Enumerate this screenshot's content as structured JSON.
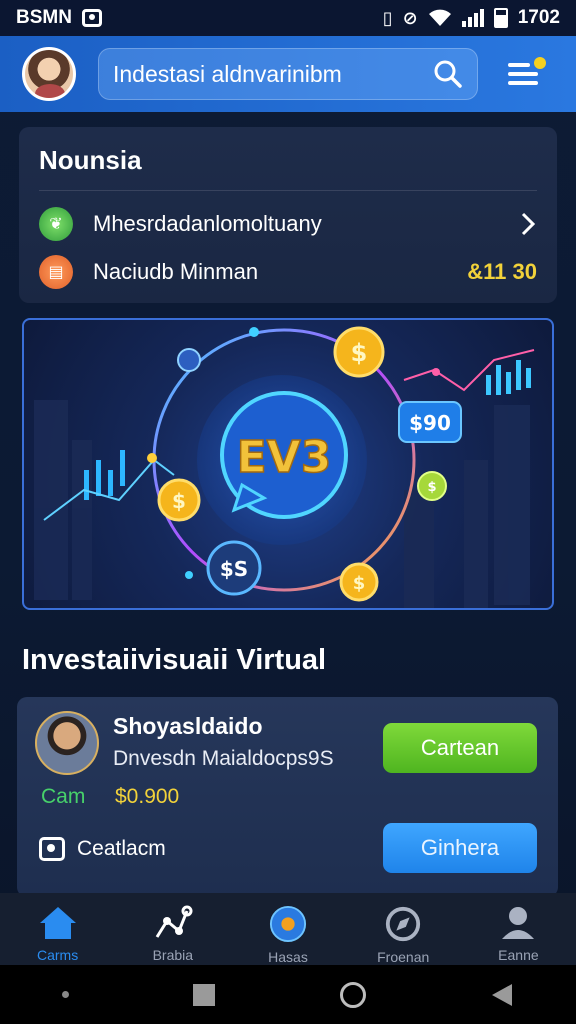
{
  "status_bar": {
    "carrier": "BSMN",
    "time": "1702"
  },
  "header": {
    "search_text": "Indestasi aldnvarinibm",
    "icons": [
      "avatar",
      "search-icon",
      "menu-icon"
    ]
  },
  "notice": {
    "title": "Nounsia",
    "rows": [
      {
        "label": "Mhesrdadanlomoltuany",
        "icon": "leaf-icon",
        "trailing": "chevron-right-icon"
      },
      {
        "label": "Naciudb Minman",
        "icon": "wallet-icon",
        "amount": "&11 30"
      }
    ]
  },
  "banner": {
    "logo_text": "EV3",
    "price_tag": "$90",
    "coin_symbol": "$",
    "dollar_bubble": "$S"
  },
  "section": {
    "title": "Investaiivisuaii Virtual"
  },
  "investment": {
    "name": "Shoyasldaido",
    "description": "Dnvesdn Maialdocps9S",
    "tag": "Cam",
    "price": "$0.900",
    "primary_button": "Cartean",
    "camera_label": "Ceatlacm",
    "secondary_button": "Ginhera"
  },
  "bottom_nav": {
    "items": [
      {
        "label": "Carms",
        "icon": "home-icon",
        "active": true
      },
      {
        "label": "Brabia",
        "icon": "chart-nodes-icon",
        "active": false
      },
      {
        "label": "Hasas",
        "icon": "globe-icon",
        "active": false
      },
      {
        "label": "Froenan",
        "icon": "compass-icon",
        "active": false
      },
      {
        "label": "Eanne",
        "icon": "profile-icon",
        "active": false
      }
    ]
  },
  "colors": {
    "app_bar": "#2a78e0",
    "accent_green": "#4fb520",
    "accent_blue": "#1f84ea",
    "gold": "#f2d23a"
  }
}
